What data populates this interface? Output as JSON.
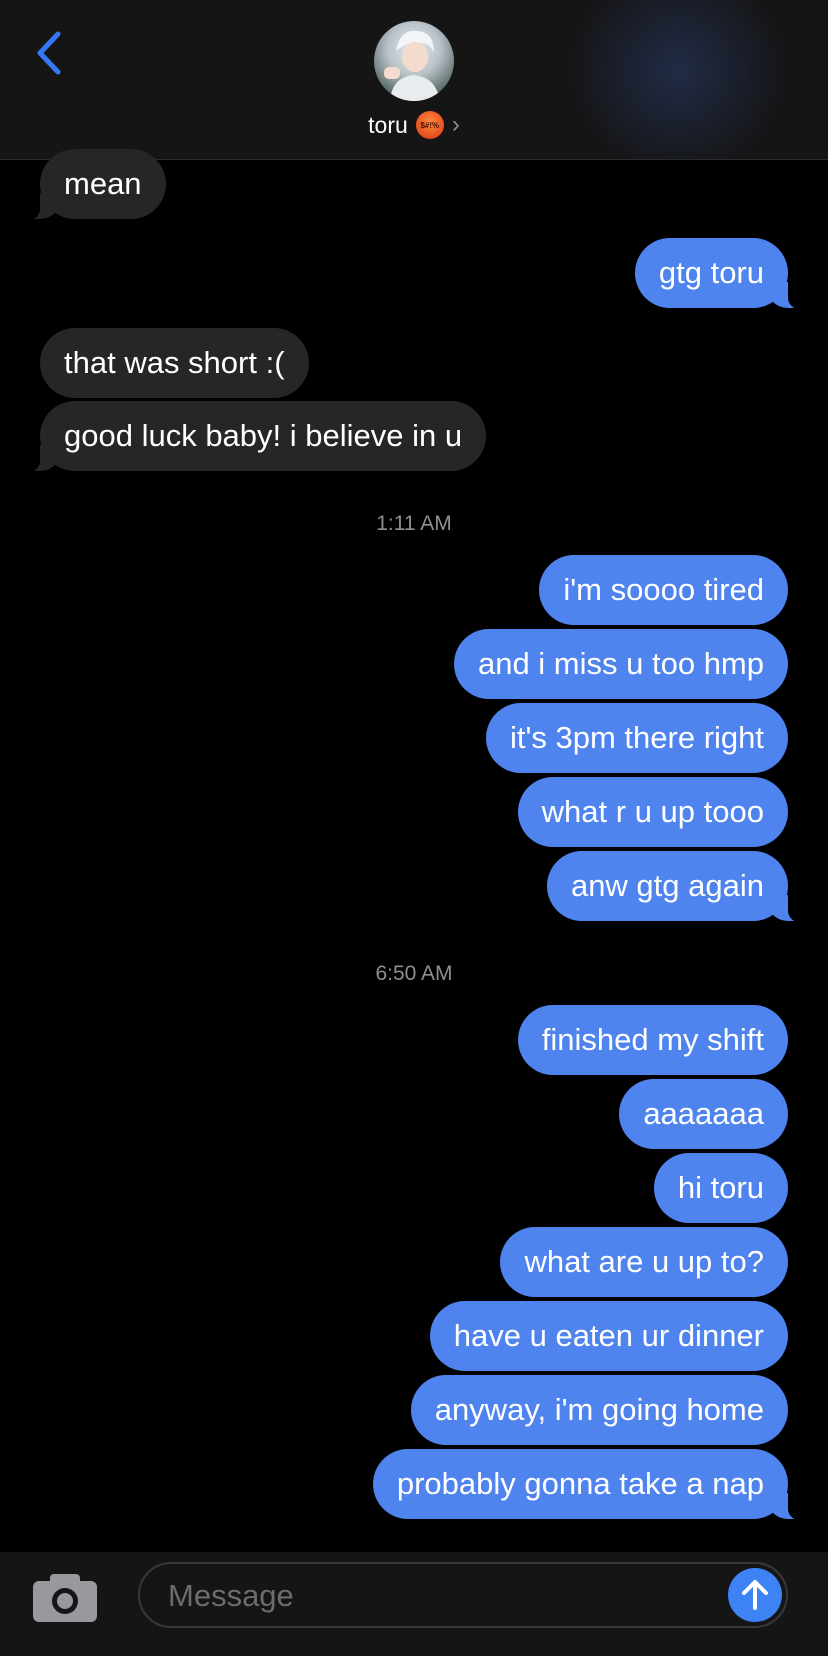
{
  "header": {
    "contact_name": "toru",
    "status_emoji_text": "$#!%",
    "accent_color": "#3478f6"
  },
  "messages": [
    {
      "side": "received",
      "text": "mean"
    },
    {
      "side": "sent",
      "text": "gtg toru"
    },
    {
      "side": "received",
      "text": "that was short :("
    },
    {
      "side": "received",
      "text": "good luck baby! i believe in u"
    },
    {
      "side": "timestamp",
      "text": "1:11 AM"
    },
    {
      "side": "sent",
      "text": "i'm soooo tired"
    },
    {
      "side": "sent",
      "text": "and i miss u too hmp"
    },
    {
      "side": "sent",
      "text": "it's 3pm there right"
    },
    {
      "side": "sent",
      "text": "what r u up tooo"
    },
    {
      "side": "sent",
      "text": "anw gtg again"
    },
    {
      "side": "timestamp",
      "text": "6:50 AM"
    },
    {
      "side": "sent",
      "text": "finished my shift"
    },
    {
      "side": "sent",
      "text": "aaaaaaa"
    },
    {
      "side": "sent",
      "text": "hi toru"
    },
    {
      "side": "sent",
      "text": "what are u up to?"
    },
    {
      "side": "sent",
      "text": "have u eaten ur dinner"
    },
    {
      "side": "sent",
      "text": "anyway, i'm going home"
    },
    {
      "side": "sent",
      "text": "probably gonna take a nap"
    }
  ],
  "composer": {
    "placeholder": "Message",
    "value": ""
  },
  "colors": {
    "sent_bubble": "#4f84ee",
    "received_bubble": "#262629",
    "background": "#000000"
  },
  "icons": [
    "back-chevron-icon",
    "chevron-right-icon",
    "camera-icon",
    "send-arrow-icon"
  ]
}
